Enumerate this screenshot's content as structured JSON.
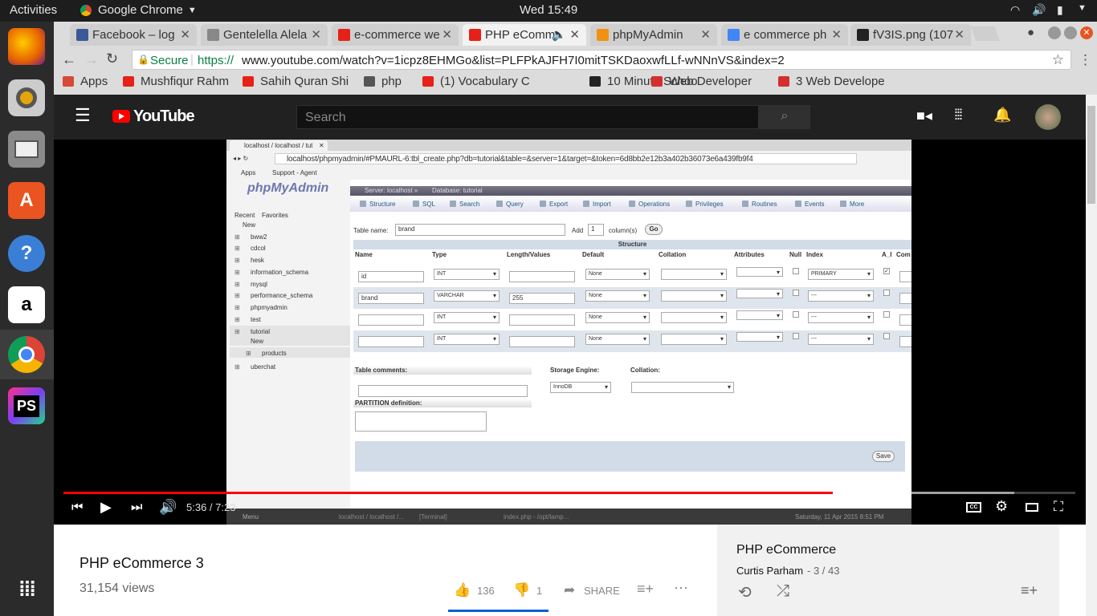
{
  "os": {
    "activities": "Activities",
    "app_menu": "Google Chrome",
    "clock": "Wed 15:49"
  },
  "tabs": [
    {
      "label": "Facebook – log",
      "color": "#3b5998"
    },
    {
      "label": "Gentelella Alela",
      "color": "#888888"
    },
    {
      "label": "e-commerce we",
      "color": "#e62117"
    },
    {
      "label": "PHP eComm",
      "color": "#e62117"
    },
    {
      "label": "phpMyAdmin",
      "color": "#f29111"
    },
    {
      "label": "e commerce ph",
      "color": "#4285f4"
    },
    {
      "label": "fV3IS.png (107",
      "color": "#222222"
    }
  ],
  "address": {
    "secure": "Secure",
    "url_prefix": "https://",
    "url": "www.youtube.com/watch?v=1icpz8EHMGo&list=PLFPkAJFH7I0mitTSKDaoxwfLLf-wNNnVS&index=2"
  },
  "bookmarks": [
    {
      "label": "Apps",
      "color": "#d64937"
    },
    {
      "label": "Mushfiqur Rahm",
      "color": "#e62117"
    },
    {
      "label": "Sahih Quran Shi",
      "color": "#e62117"
    },
    {
      "label": "php",
      "color": "#555555"
    },
    {
      "label": "(1) Vocabulary C",
      "color": "#e62117"
    },
    {
      "label": "10 Minute Schoo",
      "color": "#222222"
    },
    {
      "label": "Web Developer",
      "color": "#d32f2f"
    },
    {
      "label": "3 Web Develope",
      "color": "#d32f2f"
    }
  ],
  "youtube": {
    "brand": "YouTube",
    "search_placeholder": "Search",
    "time": "5:36 / 7:23",
    "progress": 0.76,
    "buffered": 0.94,
    "video_title": "PHP eCommerce 3",
    "views": "31,154 views",
    "likes": "136",
    "dislikes": "1",
    "share": "SHARE",
    "playlist_title": "PHP eCommerce",
    "playlist_author": "Curtis Parham",
    "playlist_pos": "- 3 / 43"
  },
  "pma": {
    "tab_title": "localhost / localhost / tut",
    "url": "localhost/phpmyadmin/#PMAURL-6:tbl_create.php?db=tutorial&table=&server=1&target=&token=6d8bb2e12b3a402b36073e6a439fb9f4",
    "bm_apps": "Apps",
    "bm_support": "Support - Agent",
    "logo": "phpMyAdmin",
    "recent": "Recent",
    "favorites": "Favorites",
    "breadcrumb_server": "Server: localhost »",
    "breadcrumb_db": "Database: tutorial",
    "tree": [
      "New",
      "bww2",
      "cdcol",
      "hesk",
      "information_schema",
      "mysql",
      "performance_schema",
      "phpmyadmin",
      "test",
      "tutorial",
      "New",
      "products",
      "uberchat"
    ],
    "menu": [
      "Structure",
      "SQL",
      "Search",
      "Query",
      "Export",
      "Import",
      "Operations",
      "Privileges",
      "Routines",
      "Events",
      "More"
    ],
    "table_name_label": "Table name:",
    "table_name": "brand",
    "add_label": "Add",
    "add_count": "1",
    "columns_label": "column(s)",
    "go": "Go",
    "structure": "Structure",
    "headers": [
      "Name",
      "Type",
      "Length/Values",
      "Default",
      "Collation",
      "Attributes",
      "Null",
      "Index",
      "A_I",
      "Com"
    ],
    "rows": [
      {
        "name": "id",
        "type": "INT",
        "length": "",
        "default": "None",
        "index": "PRIMARY"
      },
      {
        "name": "brand",
        "type": "VARCHAR",
        "length": "255",
        "default": "None",
        "index": "---"
      },
      {
        "name": "",
        "type": "INT",
        "length": "",
        "default": "None",
        "index": "---"
      },
      {
        "name": "",
        "type": "INT",
        "length": "",
        "default": "None",
        "index": "---"
      }
    ],
    "table_comments": "Table comments:",
    "storage_engine": "Storage Engine:",
    "engine": "InnoDB",
    "collation": "Collation:",
    "partition": "PARTITION definition:",
    "save": "Save",
    "taskbar_menu": "Menu",
    "taskbar_item1": "localhost / localhost /...",
    "taskbar_item2": "[Terminal]",
    "taskbar_item3": "index.php - /opt/lamp...",
    "taskbar_clock": "Saturday, 11 Apr 2015  8:51 PM"
  }
}
